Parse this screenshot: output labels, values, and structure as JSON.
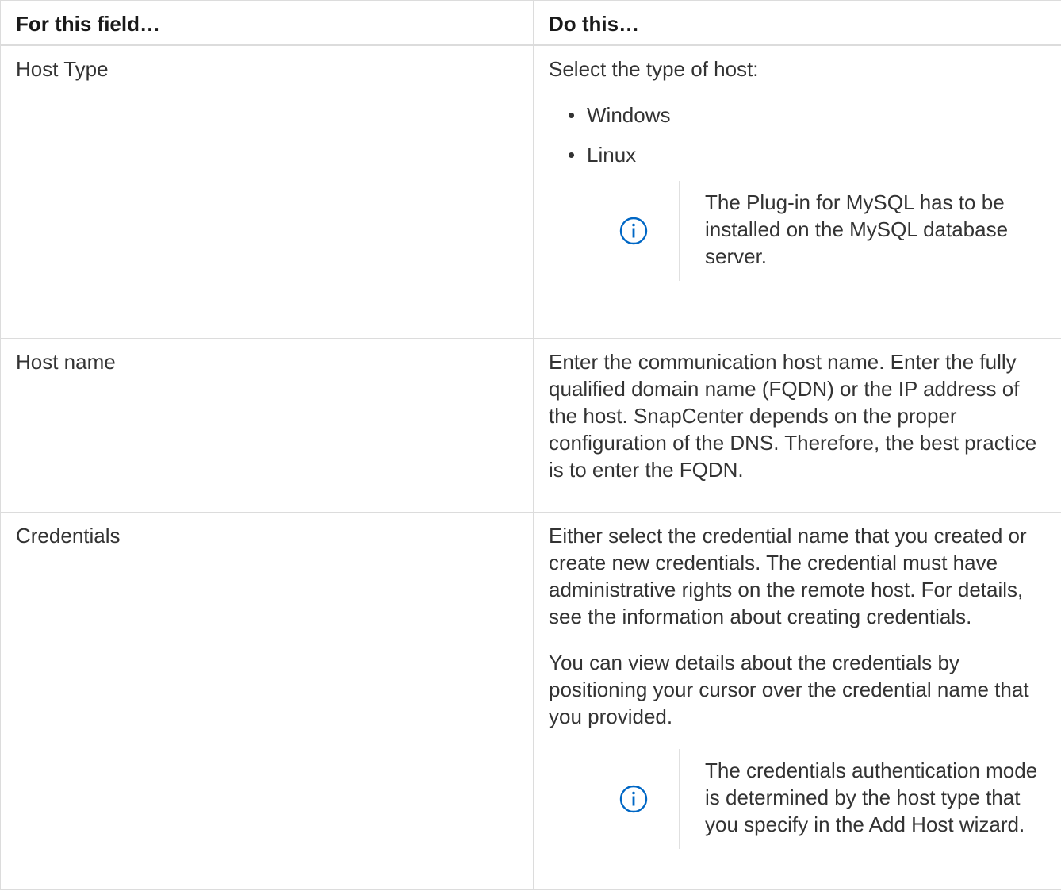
{
  "table": {
    "header": {
      "field": "For this field…",
      "action": "Do this…"
    },
    "rows": {
      "host_type": {
        "field": "Host Type",
        "intro": "Select the type of host:",
        "options": [
          "Windows",
          "Linux"
        ],
        "note": "The Plug-in for MySQL has to be installed on the MySQL database server."
      },
      "host_name": {
        "field": "Host name",
        "description": "Enter the communication host name. Enter the fully qualified domain name (FQDN) or the IP address of the host. SnapCenter depends on the proper configuration of the DNS. Therefore, the best practice is to enter the FQDN."
      },
      "credentials": {
        "field": "Credentials",
        "paragraph1": "Either select the credential name that you created or create new credentials. The credential must have administrative rights on the remote host. For details, see the information about creating credentials.",
        "paragraph2": "You can view details about the credentials by positioning your cursor over the credential name that you provided.",
        "note": "The credentials authentication mode is determined by the host type that you specify in the Add Host wizard."
      }
    }
  },
  "icons": {
    "note": "info-circle-icon"
  },
  "colors": {
    "text": "#333333",
    "border": "#dcdcdc",
    "info_icon": "#0067c5"
  }
}
